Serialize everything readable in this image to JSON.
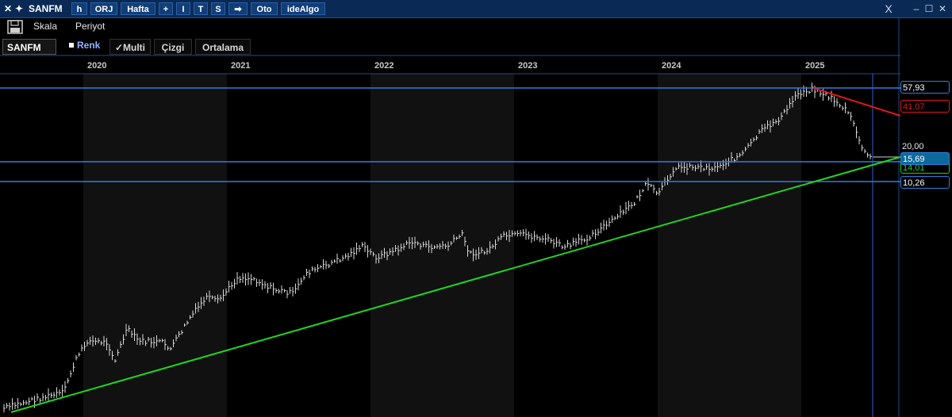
{
  "topbar": {
    "close_glyph": "✕",
    "back_glyph": "✦",
    "symbol": "SANFM",
    "btn_h": "h",
    "btn_orj": "ORJ",
    "btn_period": "Hafta",
    "btn_plus": "+",
    "btn_i": "I",
    "btn_t": "T",
    "btn_s": "S",
    "btn_arrow": "➡",
    "btn_oto": "Oto",
    "btn_idealgo": "ideAlgo",
    "win_x": "X",
    "win_min": "–",
    "win_max": "☐",
    "win_close": "✕"
  },
  "toolbar2": {
    "scale": "Skala",
    "period": "Periyot"
  },
  "tabs": {
    "symbol_tab": "SANFM",
    "color": "Renk",
    "multi": "✓Multi",
    "line": "Çizgi",
    "average": "Ortalama"
  },
  "x_axis": {
    "years": [
      "2020",
      "2021",
      "2022",
      "2023",
      "2024",
      "2025"
    ]
  },
  "price_labels": {
    "l1": "57,93",
    "l2": "41,07",
    "l3": "20,00",
    "l4": "15,69",
    "l5": "14,01",
    "l6": "10,26"
  },
  "colors": {
    "background": "#000000",
    "candles": "#d9d9d9",
    "hline": "#2f7fe0",
    "support": "#20d620",
    "resistance": "#e01818",
    "cursor": "#2f5fd0"
  }
}
